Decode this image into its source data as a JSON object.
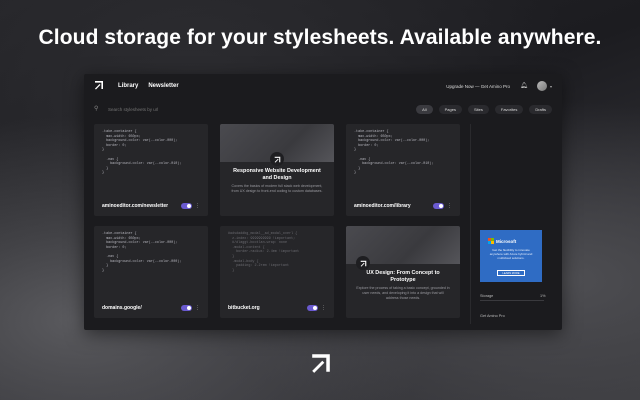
{
  "headline": "Cloud storage for your stylesheets. Available anywhere.",
  "nav": {
    "library": "Library",
    "newsletter": "Newsletter"
  },
  "topbar": {
    "upgrade": "Upgrade Now — Get Amino Pro"
  },
  "search": {
    "placeholder": "Search stylesheets by url"
  },
  "filters": [
    "All",
    "Pages",
    "Sites",
    "Favorites",
    "Drafts"
  ],
  "cards": {
    "c1": {
      "site": "aminoeditor.com/newsletter",
      "code": ".take-container {\n  max-width: 650px;\n  background-color: var(--color-000);\n  border: 0;\n}\n\n  .nav {\n    background-color: var(--color-010);\n  }\n}"
    },
    "c2": {
      "title": "Responsive Website Development and Design",
      "desc": "Covers the basics of modern full stack web development, from UX design to front-end coding to custom databases."
    },
    "c3": {
      "site": "aminoeditor.com/library",
      "code": ".take-container {\n  max-width: 650px;\n  background-color: var(--color-000);\n  border: 0;\n}\n\n  .nav {\n    background-color: var(--color-010);\n  }\n}"
    },
    "c4": {
      "site": "domains.google/",
      "code": ".take-container {\n  max-width: 650px;\n  background-color: var(--color-000);\n  border: 0;\n\n  .nav {\n    background-color: var(--color-000);\n  }\n}"
    },
    "c5": {
      "site": "bitbucket.org",
      "code": "#adsdaddbg_modal__ad_modal_overl {\n  z-index: 9999999999 !important;\n  #/dlaggt-bootlan-wrap: none\n  .modal-content {\n    border-radius: 2.4em !important\n  }\n  .modal-body {\n    padding: 2.2rem !important\n  }"
    },
    "c6": {
      "title": "UX Design: From Concept to Prototype",
      "desc": "Explore the process of taking a basic concept, grounded in user needs, and developing it into a design that will address those needs."
    }
  },
  "ad": {
    "brand": "Microsoft",
    "text": "Get the flexibility to innovate anywhere with Azure hybrid and multicloud solutions.",
    "cta": "LEARN MORE"
  },
  "sidebar": {
    "storage_label": "Storage",
    "storage_pct": "1%",
    "storage_used": 0.01,
    "plan": "Get Amino Pro"
  },
  "colors": {
    "accent": "#6a5ad0",
    "ad_bg": "#2f6cc4"
  }
}
